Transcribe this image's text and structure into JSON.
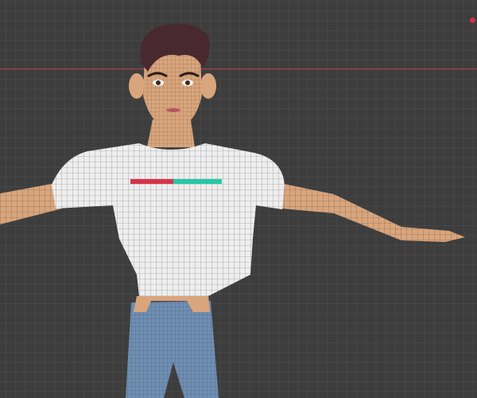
{
  "viewport": {
    "background": "#3d3d3d",
    "x_axis_color": "#b8354d",
    "origin_dot_color": "#d42f4a"
  },
  "character": {
    "skin": "#d9a57c",
    "shirt": "#eeeeee",
    "jeans": "#6f8fb3",
    "hair": "#4a2a30",
    "health_bar_left": "#d8344a",
    "health_bar_right": "#25c9a6",
    "mesh_wire": "#1e1e1e"
  }
}
